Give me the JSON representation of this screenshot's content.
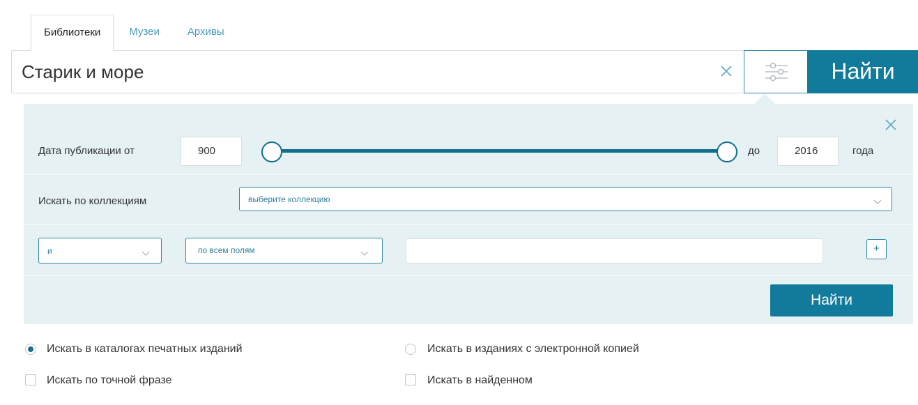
{
  "tabs": [
    {
      "label": "Библиотеки",
      "active": true
    },
    {
      "label": "Музеи",
      "active": false
    },
    {
      "label": "Архивы",
      "active": false
    }
  ],
  "search": {
    "value": "Старик и море",
    "clear_icon": "close-icon",
    "filter_icon": "sliders-icon",
    "submit_label": "Найти"
  },
  "advanced": {
    "close_icon": "close-icon",
    "date": {
      "label_from": "Дата публикации от",
      "from_value": "900",
      "label_to": "до",
      "to_value": "2016",
      "suffix": "года",
      "range": [
        900,
        2016
      ],
      "selected": [
        900,
        2016
      ]
    },
    "collections": {
      "label": "Искать по коллекциям",
      "placeholder": "выберите коллекцию"
    },
    "query_row": {
      "operator": "и",
      "field": "по всем полям",
      "value": "",
      "add_label": "+"
    },
    "submit_label": "Найти"
  },
  "options": {
    "print_catalogs": {
      "label": "Искать в каталогах печатных изданий",
      "selected": true
    },
    "electronic_copy": {
      "label": "Искать в изданиях с электронной копией",
      "selected": false
    },
    "exact_phrase": {
      "label": "Искать по точной фразе",
      "checked": false
    },
    "search_in_found": {
      "label": "Искать в найденном",
      "checked": false
    }
  },
  "colors": {
    "accent": "#127b9b",
    "link": "#4a9bb8",
    "panel_bg": "#e5f1f3"
  }
}
